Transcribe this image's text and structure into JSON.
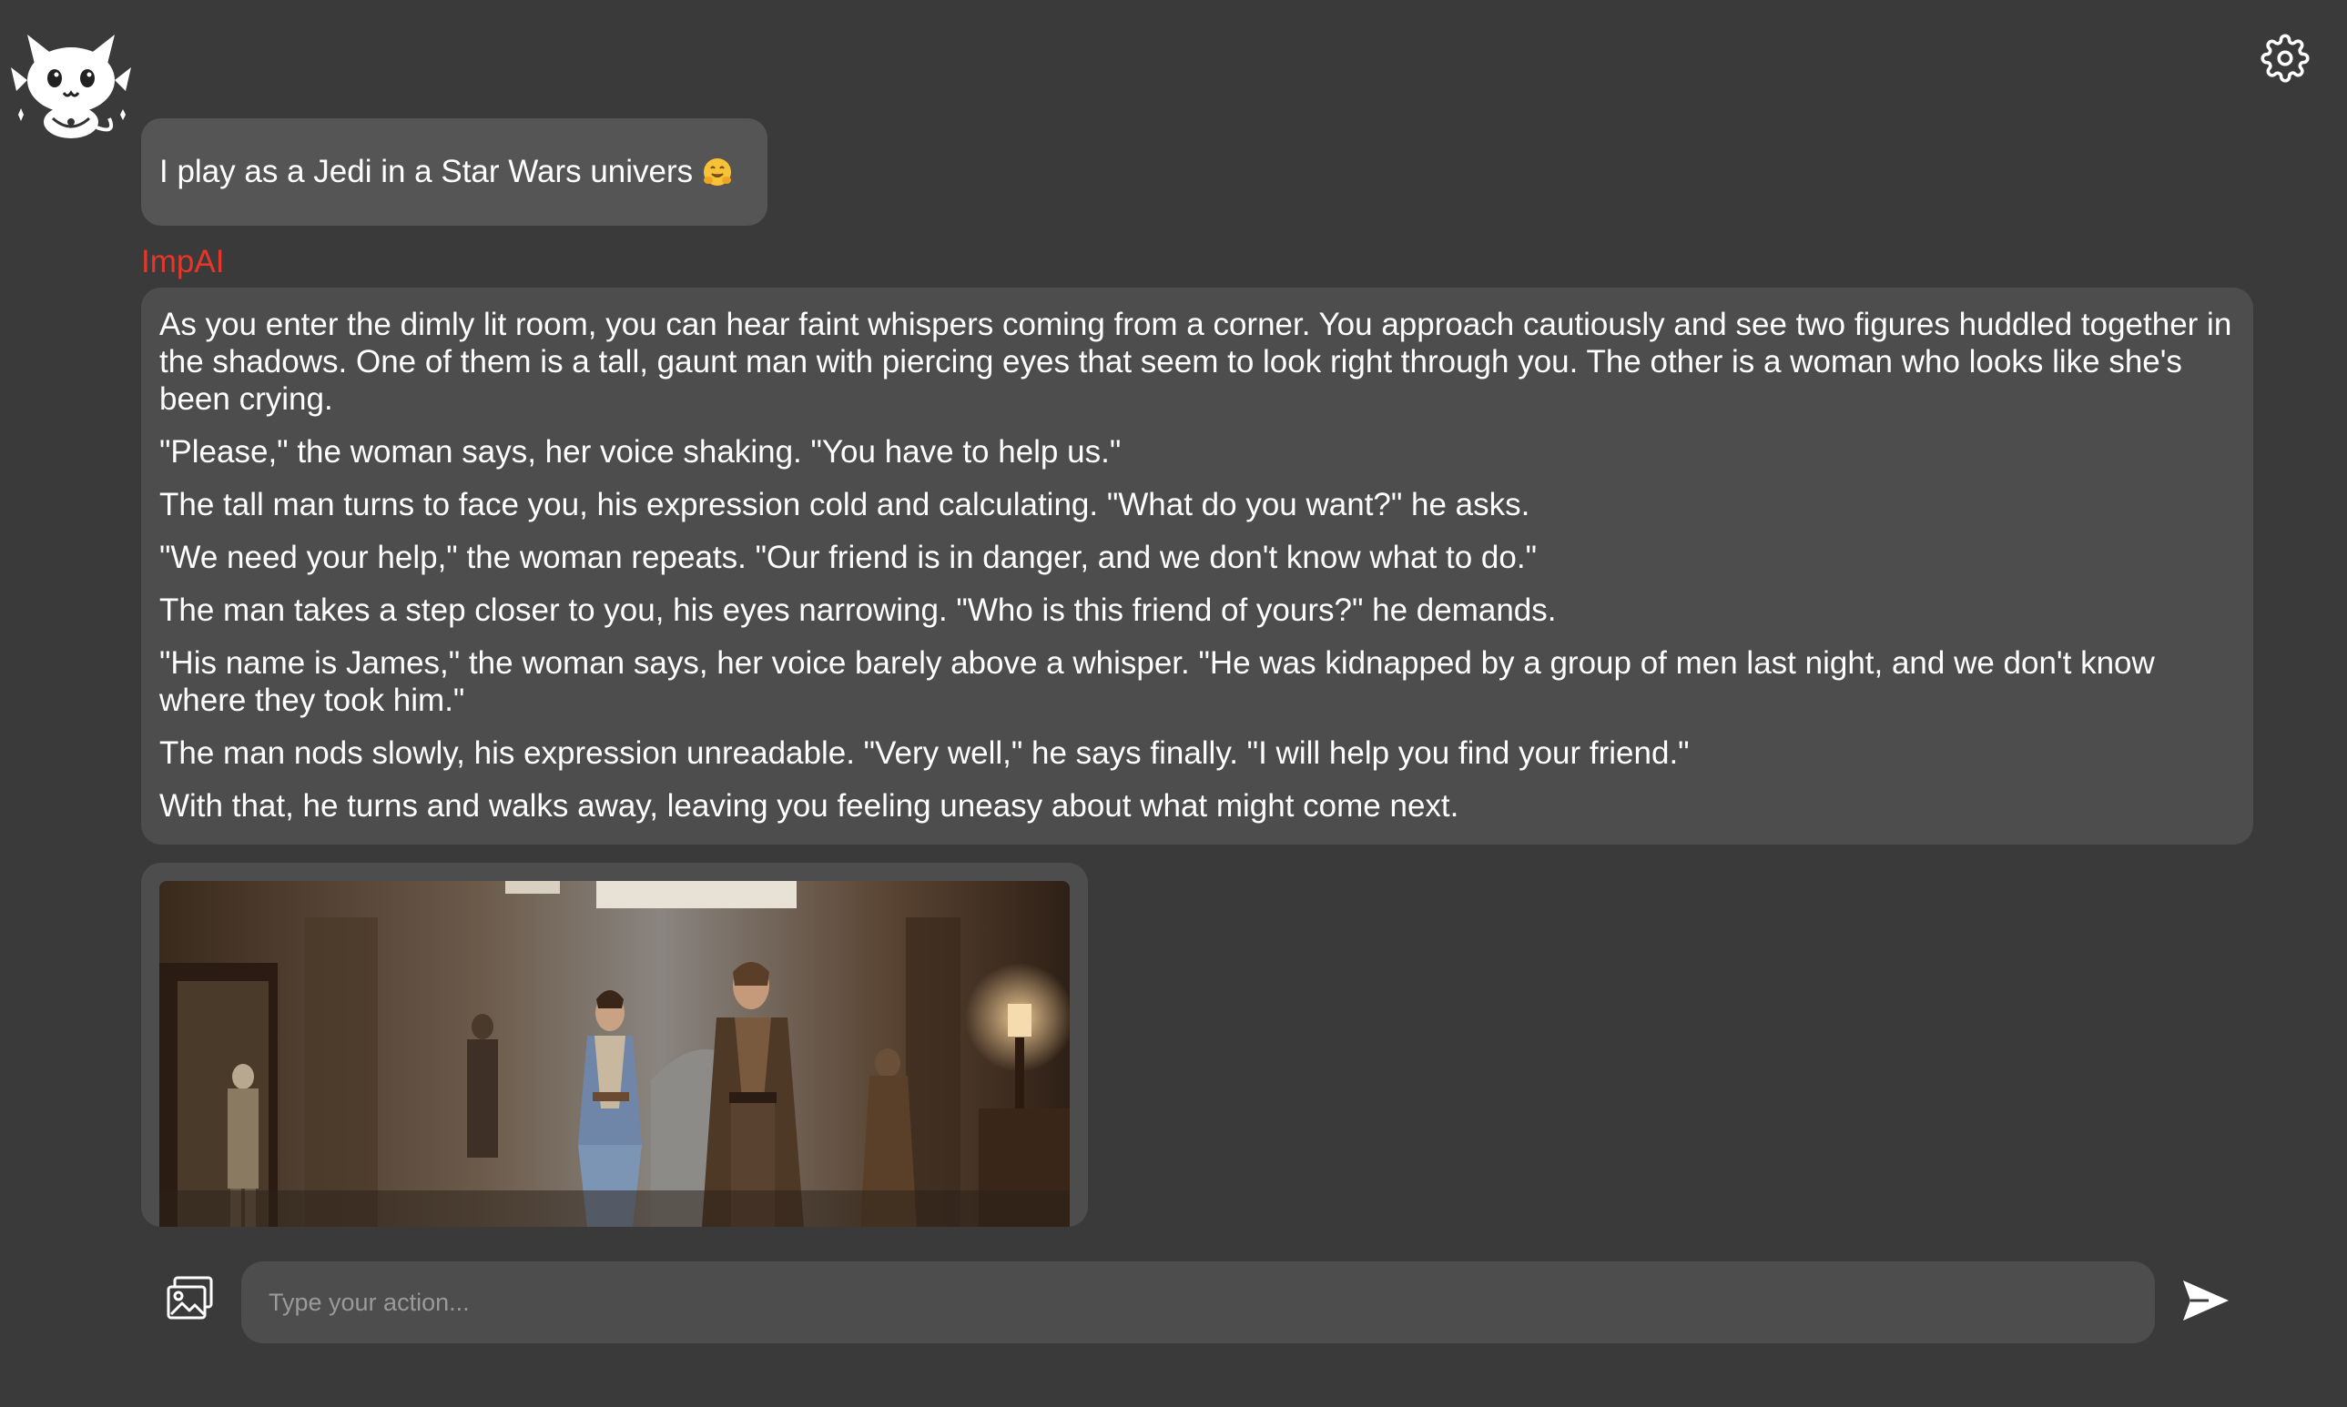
{
  "app": {
    "logo_icon": "imp-mascot-icon",
    "settings_icon": "gear-icon"
  },
  "chat": {
    "user_message": {
      "text": "I play as a Jedi in a Star Wars univers",
      "emoji": "hugging-face-emoji"
    },
    "ai_sender": "ImpAI",
    "sender_color": "#e8352a",
    "ai_message": {
      "paragraphs": [
        "As you enter the dimly lit room, you can hear faint whispers coming from a corner. You approach cautiously and see two figures huddled together in the shadows. One of them is a tall, gaunt man with piercing eyes that seem to look right through you. The other is a woman who looks like she's been crying.",
        "\"Please,\" the woman says, her voice shaking. \"You have to help us.\"",
        "The tall man turns to face you, his expression cold and calculating. \"What do you want?\" he asks.",
        "\"We need your help,\" the woman repeats. \"Our friend is in danger, and we don't know what to do.\"",
        "The man takes a step closer to you, his eyes narrowing. \"Who is this friend of yours?\" he demands.",
        "\"His name is James,\" the woman says, her voice barely above a whisper. \"He was kidnapped by a group of men last night, and we don't know where they took him.\"",
        "The man nods slowly, his expression unreadable. \"Very well,\" he says finally. \"I will help you find your friend.\"",
        "With that, he turns and walks away, leaving you feeling uneasy about what might come next."
      ]
    },
    "generated_image": "jedi-scene-image"
  },
  "input": {
    "placeholder": "Type your action...",
    "value": "",
    "image_button_icon": "image-upload-icon",
    "send_icon": "send-arrow-icon"
  }
}
